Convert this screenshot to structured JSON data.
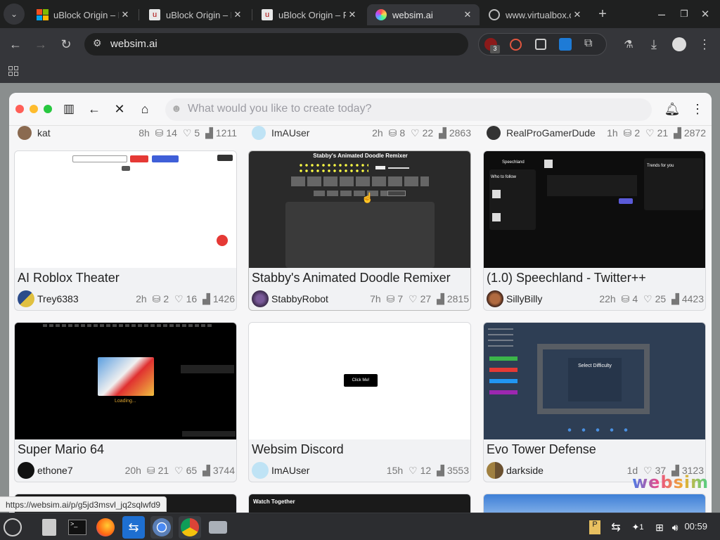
{
  "browser": {
    "tabs": [
      {
        "title": "uBlock Origin – F",
        "icon": "windows-logo-icon"
      },
      {
        "title": "uBlock Origin – F",
        "icon": "ublock-icon"
      },
      {
        "title": "uBlock Origin – F",
        "icon": "ublock-icon"
      },
      {
        "title": "websim.ai",
        "icon": "websim-icon",
        "active": true
      },
      {
        "title": "www.virtualbox.o",
        "icon": "globe-icon"
      }
    ],
    "address": "websim.ai",
    "extension_badge": "3"
  },
  "app": {
    "search_placeholder": "What would you like to create today?"
  },
  "top_row": [
    {
      "author": "kat",
      "stats": [
        "8h",
        "14",
        "5",
        "1211"
      ]
    },
    {
      "author": "ImAUser",
      "stats": [
        "2h",
        "8",
        "22",
        "2863"
      ]
    },
    {
      "author": "RealProGamerDude",
      "stats": [
        "1h",
        "2",
        "21",
        "2872"
      ]
    }
  ],
  "cards": [
    {
      "title": "AI Roblox Theater",
      "author": "Trey6383",
      "time": "2h",
      "remixes": "2",
      "likes": "16",
      "views": "1426"
    },
    {
      "title": "Stabby's Animated Doodle Remixer",
      "author": "StabbyRobot",
      "time": "7h",
      "remixes": "7",
      "likes": "27",
      "views": "2815",
      "thumb_title": "Stabby's Animated Doodle Remixer"
    },
    {
      "title": "(1.0) Speechland - Twitter++",
      "author": "SillyBilly",
      "time": "22h",
      "remixes": "4",
      "likes": "25",
      "views": "4423",
      "thumb_heading": "Speechland",
      "thumb_who": "Who to follow",
      "thumb_trends": "Trends for you"
    },
    {
      "title": "Super Mario 64",
      "author": "ethone7",
      "time": "20h",
      "remixes": "21",
      "likes": "65",
      "views": "3744",
      "thumb_loading": "Loading..."
    },
    {
      "title": "Websim Discord",
      "author": "ImAUser",
      "time": "15h",
      "likes": "12",
      "views": "3553",
      "thumb_button": "Click Me!"
    },
    {
      "title": "Evo Tower Defense",
      "author": "darkside",
      "time": "1d",
      "likes": "37",
      "views": "3123",
      "thumb_heading": "Select Difficulty"
    }
  ],
  "bottom_row_preview": "Watch Together",
  "watermark": "websim",
  "status_url": "https://websim.ai/p/g5jd3msvl_jq2sqlwfd9",
  "taskbar": {
    "clock": "00:59",
    "tray_count": "1"
  }
}
